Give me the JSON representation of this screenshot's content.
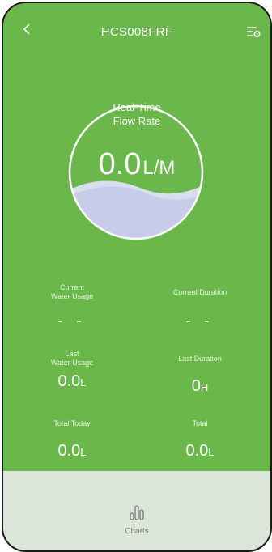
{
  "header": {
    "title": "HCS008FRF"
  },
  "gauge": {
    "title_line1": "Real-Time",
    "title_line2": "Flow Rate",
    "value": "0.0",
    "unit": "L/M",
    "colors": {
      "ring": "#ffffff",
      "water_back": "#d8ddf0",
      "water_front": "#c7cce8"
    }
  },
  "stats": {
    "current_water_usage": {
      "label_line1": "Current",
      "label_line2": "Water Usage",
      "value": "- -"
    },
    "current_duration": {
      "label": "Current Duration",
      "value": "- -"
    },
    "last_water_usage": {
      "label_line1": "Last",
      "label_line2": "Water Usage",
      "value": "0.0",
      "unit": "L"
    },
    "last_duration": {
      "label": "Last Duration",
      "value": "0",
      "unit": "H"
    },
    "total_today": {
      "label": "Total Today",
      "value": "0.0",
      "unit": "L"
    },
    "total": {
      "label": "Total",
      "value": "0.0",
      "unit": "L"
    }
  },
  "bottom_nav": {
    "charts_label": "Charts",
    "icon": "bar-chart-icon"
  },
  "colors": {
    "background": "#6ab84a",
    "bottom_bar": "#dbe6d8",
    "text": "#ffffff"
  }
}
